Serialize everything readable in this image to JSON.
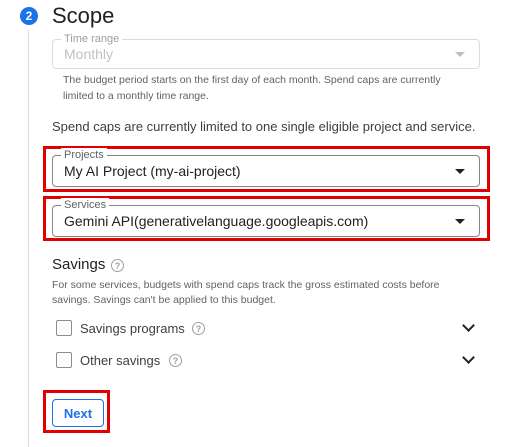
{
  "step": {
    "number": "2",
    "title": "Scope"
  },
  "time_range": {
    "label": "Time range",
    "value": "Monthly",
    "hint_line1": "The budget period starts on the first day of each month. Spend caps are currently",
    "hint_line2": "limited to a monthly time range."
  },
  "spend_caps_note": "Spend caps are currently limited to one single eligible project and service.",
  "projects": {
    "label": "Projects",
    "value": "My AI Project (my-ai-project)"
  },
  "services": {
    "label": "Services",
    "value": "Gemini API(generativelanguage.googleapis.com)"
  },
  "savings": {
    "title": "Savings",
    "help": "?",
    "hint_line1": "For some services, budgets with spend caps track the gross estimated costs before",
    "hint_line2": "savings. Savings can't be applied to this budget.",
    "options": [
      {
        "label": "Savings programs",
        "checked": false
      },
      {
        "label": "Other savings",
        "checked": false
      }
    ]
  },
  "next_label": "Next",
  "colors": {
    "accent": "#1a73e8",
    "highlight": "#e00000"
  },
  "icons": [
    "help-icon",
    "chevron-down-icon",
    "dropdown-arrow-icon"
  ]
}
